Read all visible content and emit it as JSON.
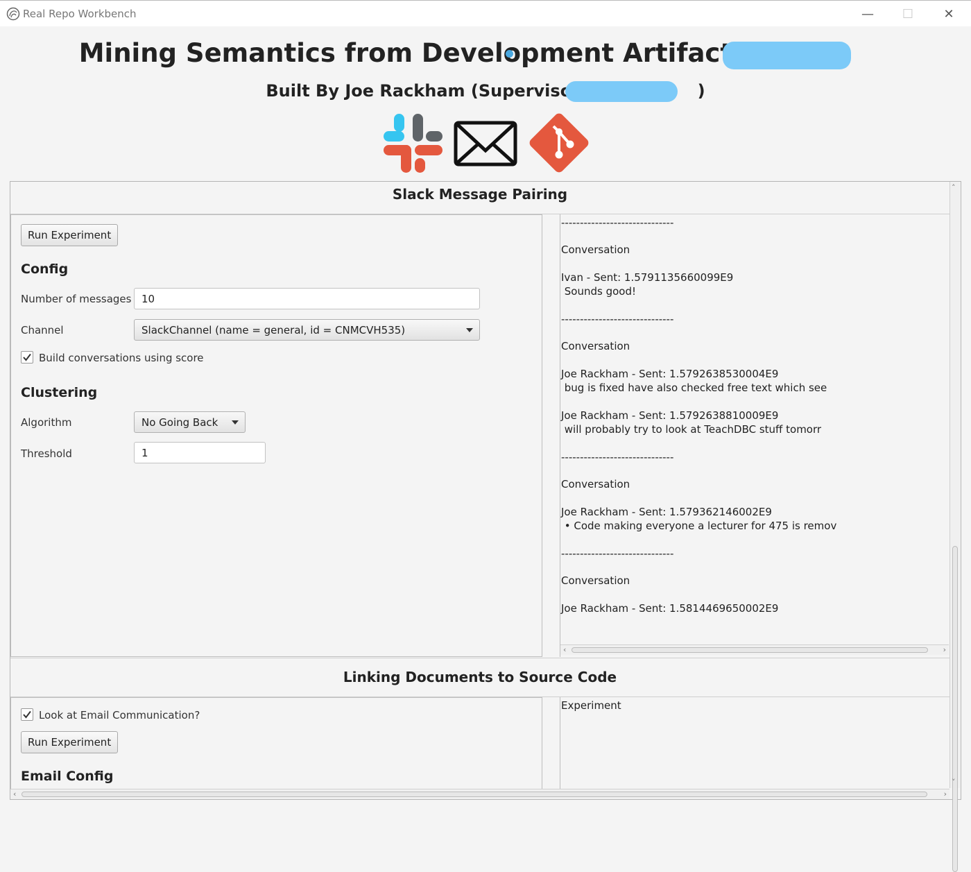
{
  "window": {
    "title": "Real Repo Workbench",
    "controls": {
      "minimize": "—",
      "maximize": "☐",
      "close": "✕"
    }
  },
  "header": {
    "title": "Mining Semantics from Development Artifacts -",
    "subtitle_prefix": "Built By Joe Rackham (Supervisor:",
    "subtitle_suffix": ")",
    "logos": [
      "slack-logo",
      "email-logo",
      "git-logo"
    ]
  },
  "colors": {
    "redaction": "#7ccaf8",
    "git": "#e4583e",
    "slack_blue": "#36c5f0",
    "slack_red": "#e01e5a"
  },
  "slack_section": {
    "title": "Slack Message Pairing",
    "run_button": "Run Experiment",
    "config_heading": "Config",
    "num_messages_label": "Number of messages",
    "num_messages_value": "10",
    "channel_label": "Channel",
    "channel_value": "SlackChannel (name = general, id = CNMCVH535)",
    "build_conversations_label": "Build conversations using score",
    "build_conversations_checked": true,
    "clustering_heading": "Clustering",
    "algorithm_label": "Algorithm",
    "algorithm_value": "No Going Back",
    "threshold_label": "Threshold",
    "threshold_value": "1",
    "output_lines": [
      "------------------------------",
      "Conversation",
      "Ivan - Sent: 1.5791135660099E9",
      " Sounds good!",
      "------------------------------",
      "Conversation",
      "Joe Rackham - Sent: 1.5792638530004E9",
      " bug is fixed have also checked free text which see",
      "Joe Rackham - Sent: 1.5792638810009E9",
      " will probably try to look at TeachDBC stuff tomorr",
      "------------------------------",
      "Conversation",
      "Joe Rackham - Sent: 1.579362146002E9",
      " • Code making everyone a lecturer for 475 is remov",
      "------------------------------",
      "Conversation",
      "Joe Rackham - Sent: 1.5814469650002E9"
    ]
  },
  "linking_section": {
    "title": "Linking Documents to Source Code",
    "email_checkbox_label": "Look at Email Communication?",
    "email_checked": true,
    "run_button": "Run Experiment",
    "email_config_heading": "Email Config",
    "output_text": "Experiment"
  }
}
